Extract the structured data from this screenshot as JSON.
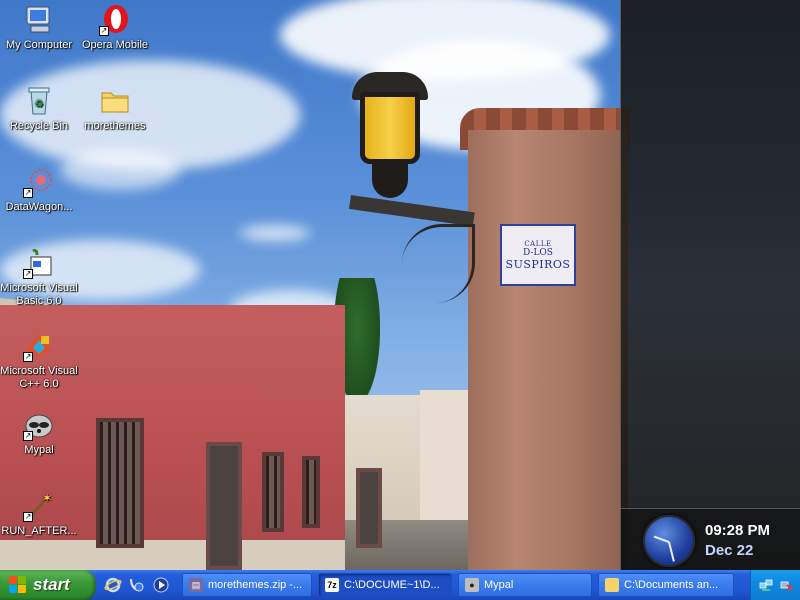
{
  "desktop": {
    "icons": [
      {
        "label": "My Computer",
        "icon": "my-computer-icon"
      },
      {
        "label": "Opera Mobile",
        "icon": "opera-icon"
      },
      {
        "label": "Recycle Bin",
        "icon": "recycle-bin-icon"
      },
      {
        "label": "morethemes",
        "icon": "folder-icon"
      },
      {
        "label": "DataWagon...",
        "icon": "datawagon-icon"
      },
      {
        "label": "Microsoft Visual Basic 6.0",
        "icon": "visual-basic-icon"
      },
      {
        "label": "Microsoft Visual C++ 6.0",
        "icon": "visual-cpp-icon"
      },
      {
        "label": "Mypal",
        "icon": "mypal-raccoon-icon"
      },
      {
        "label": "RUN_AFTER...",
        "icon": "magic-wand-icon"
      }
    ]
  },
  "wallpaper": {
    "sign": {
      "line1": "CALLE",
      "line2": "D-LOS",
      "line3": "SUSPIROS"
    }
  },
  "sidebar": {
    "clock": {
      "time": "09:28 PM",
      "date": "Dec 22"
    }
  },
  "taskbar": {
    "start_label": "start",
    "quicklaunch": [
      "internet-explorer-icon",
      "show-desktop-icon",
      "media-player-icon"
    ],
    "tasks": [
      {
        "label": "morethemes.zip -...",
        "icon": "winrar-icon",
        "active": false
      },
      {
        "label": "C:\\DOCUME~1\\D...",
        "icon": "7zip-icon",
        "active": true
      },
      {
        "label": "Mypal",
        "icon": "mypal-raccoon-icon",
        "active": false
      },
      {
        "label": "C:\\Documents an...",
        "icon": "folder-icon",
        "active": false
      }
    ],
    "tray": [
      "network-icon",
      "safely-remove-hardware-icon"
    ]
  },
  "colors": {
    "taskbar": "#245edb",
    "start": "#3c9a3a",
    "tray": "#0f8ae0",
    "sidebar": "#1e1e1e"
  }
}
